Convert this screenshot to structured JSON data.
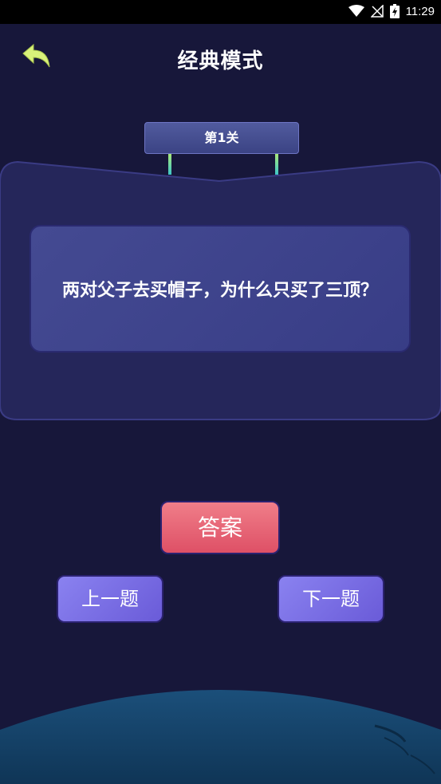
{
  "status_bar": {
    "time": "11:29"
  },
  "header": {
    "title": "经典模式"
  },
  "level": {
    "label": "第1关"
  },
  "question": {
    "text": "两对父子去买帽子，为什么只买了三顶？"
  },
  "buttons": {
    "answer": "答案",
    "prev": "上一题",
    "next": "下一题"
  },
  "colors": {
    "background": "#17173a",
    "card": "#25265a",
    "question_box": "#3f4590",
    "answer_button": "#e8677a",
    "nav_button": "#7a6ee6",
    "back_arrow": "#d9f27a"
  }
}
